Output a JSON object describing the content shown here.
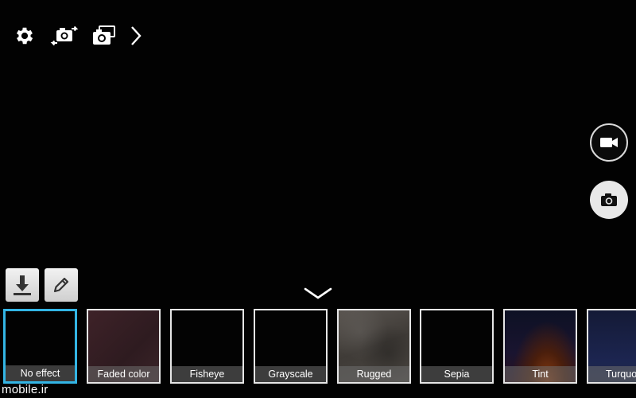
{
  "top_controls": {
    "icons": [
      "gear-icon",
      "switch-camera-icon",
      "dual-camera-icon",
      "chevron-right-icon"
    ]
  },
  "modes": {
    "video_icon": "video-camera-icon",
    "camera_icon": "camera-icon"
  },
  "tools": {
    "download_icon": "download-icon",
    "edit_icon": "pencil-icon",
    "collapse_icon": "chevron-down-icon"
  },
  "effects": [
    {
      "label": "No effect",
      "selected": true
    },
    {
      "label": "Faded color",
      "selected": false
    },
    {
      "label": "Fisheye",
      "selected": false
    },
    {
      "label": "Grayscale",
      "selected": false
    },
    {
      "label": "Rugged",
      "selected": false
    },
    {
      "label": "Sepia",
      "selected": false
    },
    {
      "label": "Tint",
      "selected": false
    },
    {
      "label": "Turquoise",
      "selected": false
    }
  ],
  "watermark": "mobile.ir",
  "colors": {
    "selected_border": "#33b5e5",
    "background": "#000000"
  }
}
